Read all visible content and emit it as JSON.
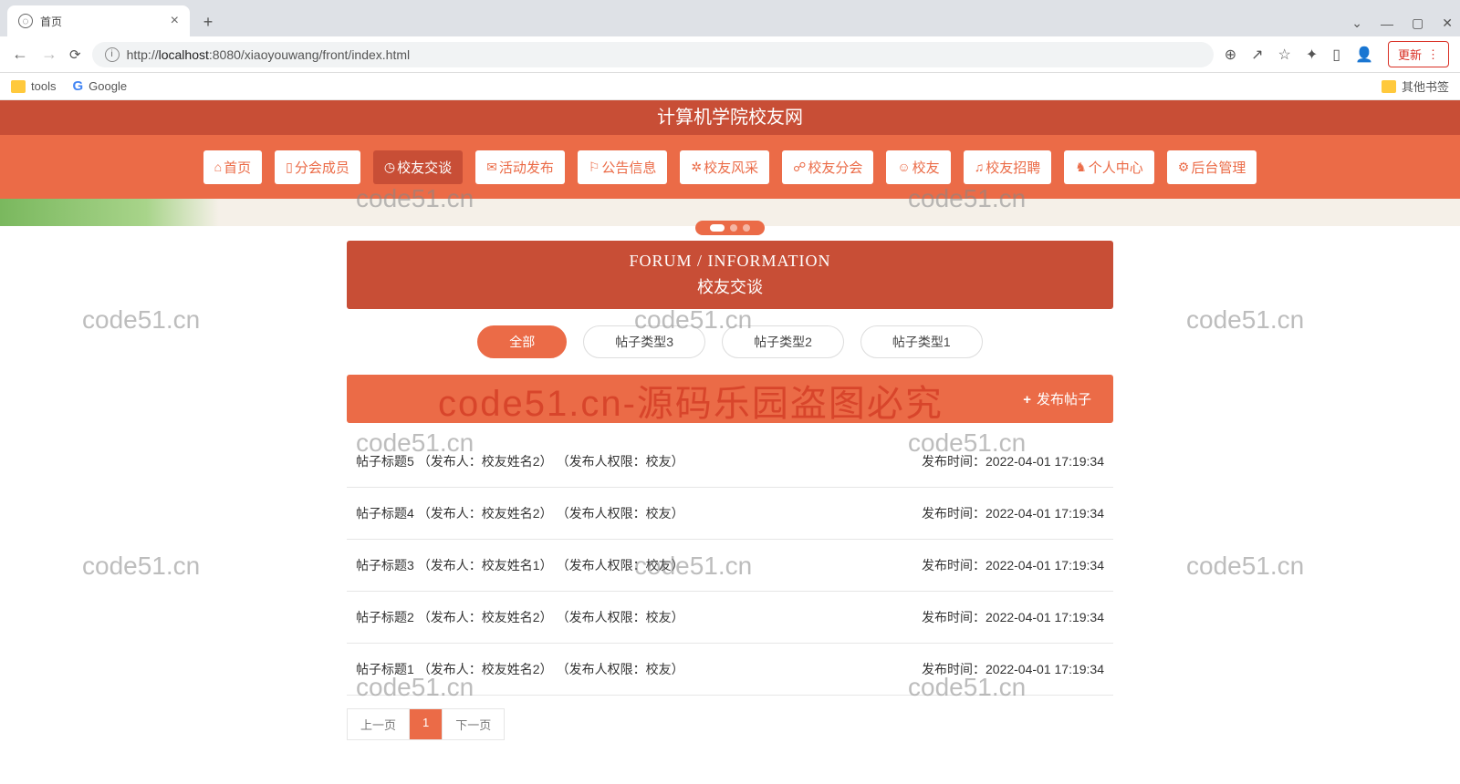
{
  "browser": {
    "tab_title": "首页",
    "url_prefix": "http://",
    "url_host": "localhost",
    "url_port_path": ":8080/xiaoyouwang/front/index.html",
    "update_label": "更新"
  },
  "bookmarks": {
    "tools": "tools",
    "google": "Google",
    "other": "其他书签"
  },
  "header": {
    "site_title": "计算机学院校友网"
  },
  "nav": [
    {
      "icon": "⌂",
      "label": "首页"
    },
    {
      "icon": "▯",
      "label": "分会成员"
    },
    {
      "icon": "◷",
      "label": "校友交谈"
    },
    {
      "icon": "✉",
      "label": "活动发布"
    },
    {
      "icon": "⚐",
      "label": "公告信息"
    },
    {
      "icon": "✲",
      "label": "校友风采"
    },
    {
      "icon": "☍",
      "label": "校友分会"
    },
    {
      "icon": "☺",
      "label": "校友"
    },
    {
      "icon": "♫",
      "label": "校友招聘"
    },
    {
      "icon": "♞",
      "label": "个人中心"
    },
    {
      "icon": "⚙",
      "label": "后台管理"
    }
  ],
  "forum": {
    "title_en": "FORUM / INFORMATION",
    "title_cn": "校友交谈"
  },
  "filters": [
    {
      "label": "全部",
      "active": true
    },
    {
      "label": "帖子类型3",
      "active": false
    },
    {
      "label": "帖子类型2",
      "active": false
    },
    {
      "label": "帖子类型1",
      "active": false
    }
  ],
  "publish": {
    "icon": "+",
    "label": "发布帖子"
  },
  "posts": [
    {
      "title": "帖子标题5",
      "publisher": "（发布人：校友姓名2）",
      "role": "（发布人权限：校友）",
      "time_label": "发布时间：",
      "time": "2022-04-01 17:19:34"
    },
    {
      "title": "帖子标题4",
      "publisher": "（发布人：校友姓名2）",
      "role": "（发布人权限：校友）",
      "time_label": "发布时间：",
      "time": "2022-04-01 17:19:34"
    },
    {
      "title": "帖子标题3",
      "publisher": "（发布人：校友姓名1）",
      "role": "（发布人权限：校友）",
      "time_label": "发布时间：",
      "time": "2022-04-01 17:19:34"
    },
    {
      "title": "帖子标题2",
      "publisher": "（发布人：校友姓名2）",
      "role": "（发布人权限：校友）",
      "time_label": "发布时间：",
      "time": "2022-04-01 17:19:34"
    },
    {
      "title": "帖子标题1",
      "publisher": "（发布人：校友姓名2）",
      "role": "（发布人权限：校友）",
      "time_label": "发布时间：",
      "time": "2022-04-01 17:19:34"
    }
  ],
  "pagination": {
    "prev": "上一页",
    "page": "1",
    "next": "下一页"
  },
  "watermarks": {
    "small": "code51.cn",
    "big": "code51.cn-源码乐园盗图必究"
  }
}
